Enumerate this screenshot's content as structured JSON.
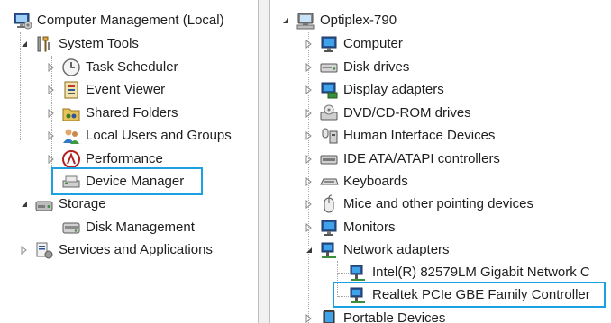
{
  "left_tree": {
    "root": {
      "label": "Computer Management (Local)",
      "icon": "computer-management-icon"
    },
    "system_tools": {
      "label": "System Tools",
      "icon": "tools-icon"
    },
    "task_scheduler": {
      "label": "Task Scheduler",
      "icon": "clock-icon"
    },
    "event_viewer": {
      "label": "Event Viewer",
      "icon": "event-viewer-icon"
    },
    "shared_folders": {
      "label": "Shared Folders",
      "icon": "shared-folder-icon"
    },
    "local_users": {
      "label": "Local Users and Groups",
      "icon": "users-icon"
    },
    "performance": {
      "label": "Performance",
      "icon": "performance-icon"
    },
    "device_manager": {
      "label": "Device Manager",
      "icon": "device-manager-icon",
      "highlighted": true
    },
    "storage": {
      "label": "Storage",
      "icon": "storage-icon"
    },
    "disk_management": {
      "label": "Disk Management",
      "icon": "disk-management-icon"
    },
    "services_apps": {
      "label": "Services and Applications",
      "icon": "services-icon"
    }
  },
  "right_tree": {
    "root": {
      "label": "Optiplex-790",
      "icon": "computer-icon"
    },
    "items": [
      {
        "label": "Computer",
        "icon": "monitor-icon"
      },
      {
        "label": "Disk drives",
        "icon": "disk-drive-icon"
      },
      {
        "label": "Display adapters",
        "icon": "display-adapter-icon"
      },
      {
        "label": "DVD/CD-ROM drives",
        "icon": "dvd-icon"
      },
      {
        "label": "Human Interface Devices",
        "icon": "hid-icon"
      },
      {
        "label": "IDE ATA/ATAPI controllers",
        "icon": "ide-icon"
      },
      {
        "label": "Keyboards",
        "icon": "keyboard-icon"
      },
      {
        "label": "Mice and other pointing devices",
        "icon": "mouse-icon"
      },
      {
        "label": "Monitors",
        "icon": "monitor-icon"
      },
      {
        "label": "Network adapters",
        "icon": "network-icon"
      }
    ],
    "network_children": [
      {
        "label": "Intel(R) 82579LM Gigabit Network C",
        "icon": "network-card-icon"
      },
      {
        "label": "Realtek PCIe GBE Family Controller",
        "icon": "network-card-icon",
        "highlighted": true
      }
    ],
    "last_item": {
      "label": "Portable Devices",
      "icon": "portable-device-icon"
    }
  },
  "colors": {
    "highlight_border": "#1ba1e2",
    "tree_lines": "#a8a8a8"
  }
}
